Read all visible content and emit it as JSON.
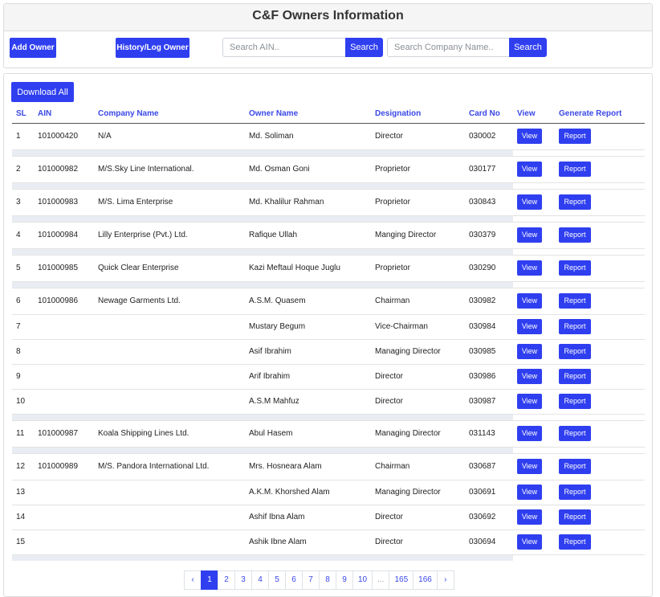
{
  "header": {
    "title": "C&F Owners Information",
    "add_owner_label": "Add Owner",
    "history_label": "History/Log Owner",
    "ain_search_placeholder": "Search AIN..",
    "ain_search_label": "Search",
    "company_search_placeholder": "Search Company Name..",
    "company_search_label": "Search"
  },
  "download_label": "Download All",
  "columns": [
    "SL",
    "AIN",
    "Company Name",
    "Owner Name",
    "Designation",
    "Card No",
    "View",
    "Generate Report"
  ],
  "row_button_labels": {
    "view": "View",
    "report": "Report"
  },
  "groups": [
    {
      "rows": [
        {
          "sl": "1",
          "ain": "101000420",
          "company": "N/A",
          "owner": "Md. Soliman",
          "designation": "Director",
          "card": "030002"
        }
      ]
    },
    {
      "rows": [
        {
          "sl": "2",
          "ain": "101000982",
          "company": "M/S.Sky Line International.",
          "owner": "Md. Osman Goni",
          "designation": "Proprietor",
          "card": "030177"
        }
      ]
    },
    {
      "rows": [
        {
          "sl": "3",
          "ain": "101000983",
          "company": "M/S. Lima Enterprise",
          "owner": "Md. Khalilur Rahman",
          "designation": "Proprietor",
          "card": "030843"
        }
      ]
    },
    {
      "rows": [
        {
          "sl": "4",
          "ain": "101000984",
          "company": "Lilly Enterprise (Pvt.) Ltd.",
          "owner": "Rafique Ullah",
          "designation": "Manging Director",
          "card": "030379"
        }
      ]
    },
    {
      "rows": [
        {
          "sl": "5",
          "ain": "101000985",
          "company": "Quick Clear Enterprise",
          "owner": "Kazi Meftaul Hoque Juglu",
          "designation": "Proprietor",
          "card": "030290"
        }
      ]
    },
    {
      "rows": [
        {
          "sl": "6",
          "ain": "101000986",
          "company": "Newage Garments Ltd.",
          "owner": "A.S.M. Quasem",
          "designation": "Chairman",
          "card": "030982"
        },
        {
          "sl": "7",
          "ain": "",
          "company": "",
          "owner": "Mustary Begum",
          "designation": "Vice-Chairman",
          "card": "030984"
        },
        {
          "sl": "8",
          "ain": "",
          "company": "",
          "owner": "Asif Ibrahim",
          "designation": "Managing Director",
          "card": "030985"
        },
        {
          "sl": "9",
          "ain": "",
          "company": "",
          "owner": "Arif Ibrahim",
          "designation": "Director",
          "card": "030986"
        },
        {
          "sl": "10",
          "ain": "",
          "company": "",
          "owner": "A.S.M Mahfuz",
          "designation": "Director",
          "card": "030987"
        }
      ]
    },
    {
      "rows": [
        {
          "sl": "11",
          "ain": "101000987",
          "company": "Koala Shipping Lines Ltd.",
          "owner": "Abul Hasem",
          "designation": "Managing Director",
          "card": "031143"
        }
      ]
    },
    {
      "rows": [
        {
          "sl": "12",
          "ain": "101000989",
          "company": "M/S. Pandora International Ltd.",
          "owner": "Mrs. Hosneara Alam",
          "designation": "Chairman",
          "card": "030687"
        },
        {
          "sl": "13",
          "ain": "",
          "company": "",
          "owner": "A.K.M. Khorshed Alam",
          "designation": "Managing Director",
          "card": "030691"
        },
        {
          "sl": "14",
          "ain": "",
          "company": "",
          "owner": "Ashif Ibna Alam",
          "designation": "Director",
          "card": "030692"
        },
        {
          "sl": "15",
          "ain": "",
          "company": "",
          "owner": "Ashik Ibne Alam",
          "designation": "Director",
          "card": "030694"
        }
      ]
    }
  ],
  "pagination": {
    "prev": "‹",
    "next": "›",
    "pages": [
      "1",
      "2",
      "3",
      "4",
      "5",
      "6",
      "7",
      "8",
      "9",
      "10",
      "...",
      "165",
      "166"
    ],
    "current": "1"
  }
}
